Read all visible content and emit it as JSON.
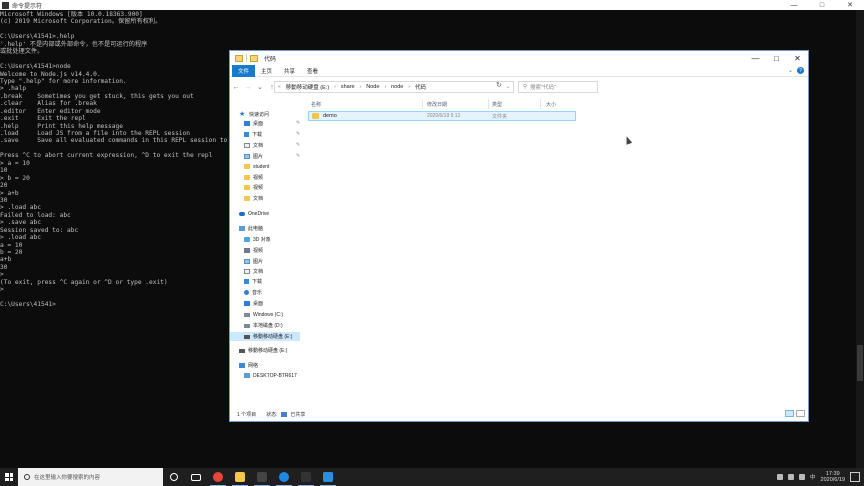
{
  "cmd": {
    "title": "命令提示符",
    "window_controls": [
      "—",
      "□",
      "✕"
    ],
    "lines": [
      "Microsoft Windows [版本 10.0.18363.900]",
      "(c) 2019 Microsoft Corporation。保留所有权利。",
      "",
      "C:\\Users\\41541>.help",
      "'.help' 不是内部或外部命令，也不是可运行的程序",
      "或批处理文件。",
      "",
      "C:\\Users\\41541>node",
      "Welcome to Node.js v14.4.0.",
      "Type \".help\" for more information.",
      "> .halp",
      ".break    Sometimes you get stuck, this gets you out",
      ".clear    Alias for .break",
      ".editor   Enter editor mode",
      ".exit     Exit the repl",
      ".help     Print this help message",
      ".load     Load JS from a file into the REPL session",
      ".save     Save all evaluated commands in this REPL session to a",
      "",
      "Press ^C to abort current expression, ^D to exit the repl",
      "> a = 10",
      "10",
      "> b = 20",
      "20",
      "> a+b",
      "30",
      "> .load abc",
      "Failed to load: abc",
      "> .save abc",
      "Session saved to: abc",
      "> .load abc",
      "a = 10",
      "b = 20",
      "a+b",
      "30",
      ">",
      "(To exit, press ^C again or ^D or type .exit)",
      ">",
      "",
      "C:\\Users\\41541>"
    ]
  },
  "explorer": {
    "title": "代码",
    "window_controls": [
      "—",
      "□",
      "✕"
    ],
    "ribbon_tabs": [
      "文件",
      "主页",
      "共享",
      "查看"
    ],
    "ribbon_right": {
      "expand": "⌄",
      "help": "?"
    },
    "nav_buttons": [
      "←",
      "→",
      "⌄",
      "↑"
    ],
    "breadcrumb": [
      "移動移动硬盘 (E:)",
      "share",
      "Node",
      "node",
      "代码"
    ],
    "refresh": "↻",
    "search_placeholder": "搜索\"代码\"",
    "sidebar": [
      {
        "label": "快速访问",
        "icon": "star-icon",
        "pinned": false
      },
      {
        "label": "桌面",
        "icon": "desktop-icon",
        "pinned": true
      },
      {
        "label": "下载",
        "icon": "download-icon",
        "pinned": true
      },
      {
        "label": "文档",
        "icon": "document-icon",
        "pinned": true
      },
      {
        "label": "图片",
        "icon": "picture-icon",
        "pinned": true
      },
      {
        "label": "student",
        "icon": "folder-icon",
        "pinned": false
      },
      {
        "label": "视频",
        "icon": "folder-icon",
        "pinned": false
      },
      {
        "label": "视频",
        "icon": "folder-icon",
        "pinned": false
      },
      {
        "label": "文档",
        "icon": "folder-icon",
        "pinned": false
      },
      {
        "label": "OneDrive",
        "icon": "cloud-icon",
        "pinned": false
      },
      {
        "label": "此电脑",
        "icon": "computer-icon",
        "pinned": false
      },
      {
        "label": "3D 对象",
        "icon": "3d-objects-icon",
        "pinned": false
      },
      {
        "label": "视频",
        "icon": "video-icon",
        "pinned": false
      },
      {
        "label": "图片",
        "icon": "picture-icon",
        "pinned": false
      },
      {
        "label": "文档",
        "icon": "document-icon",
        "pinned": false
      },
      {
        "label": "下载",
        "icon": "download-icon",
        "pinned": false
      },
      {
        "label": "音乐",
        "icon": "music-icon",
        "pinned": false
      },
      {
        "label": "桌面",
        "icon": "desktop-icon",
        "pinned": false
      },
      {
        "label": "Windows (C:)",
        "icon": "drive-icon",
        "pinned": false
      },
      {
        "label": "本地磁盘 (D:)",
        "icon": "drive-icon",
        "pinned": false
      },
      {
        "label": "移動移动硬盘 (E:)",
        "icon": "usb-drive-icon",
        "pinned": false,
        "selected": true
      },
      {
        "label": "移動移动硬盘 (E:)",
        "icon": "usb-drive-icon",
        "pinned": false
      },
      {
        "label": "网络",
        "icon": "network-icon",
        "pinned": false
      },
      {
        "label": "DESKTOP-BTR617",
        "icon": "computer-icon",
        "pinned": false
      }
    ],
    "columns": [
      "名称",
      "修改日期",
      "类型",
      "大小"
    ],
    "files": [
      {
        "name": "demo",
        "date": "2020/6/19 5:12",
        "type": "文件夹",
        "size": ""
      }
    ],
    "status": {
      "count": "1 个项目",
      "state_label": "状态:",
      "state_value": "已共享"
    }
  },
  "taskbar": {
    "search_placeholder": "在这里输入你要搜索的内容",
    "apps": [
      {
        "icon": "cortana-icon",
        "color": "#ffffff"
      },
      {
        "icon": "task-view-icon",
        "color": "#ffffff"
      },
      {
        "icon": "chrome-icon",
        "color": "#e8453c"
      },
      {
        "icon": "file-explorer-icon",
        "color": "#f3c64b"
      },
      {
        "icon": "typora-icon",
        "color": "#444444"
      },
      {
        "icon": "edge-icon",
        "color": "#1e88e5"
      },
      {
        "icon": "terminal-icon",
        "color": "#333333"
      },
      {
        "icon": "vscode-icon",
        "color": "#2b8fe0"
      }
    ],
    "tray": {
      "ime": "中",
      "time": "17:39",
      "date": "2020/6/19"
    }
  }
}
